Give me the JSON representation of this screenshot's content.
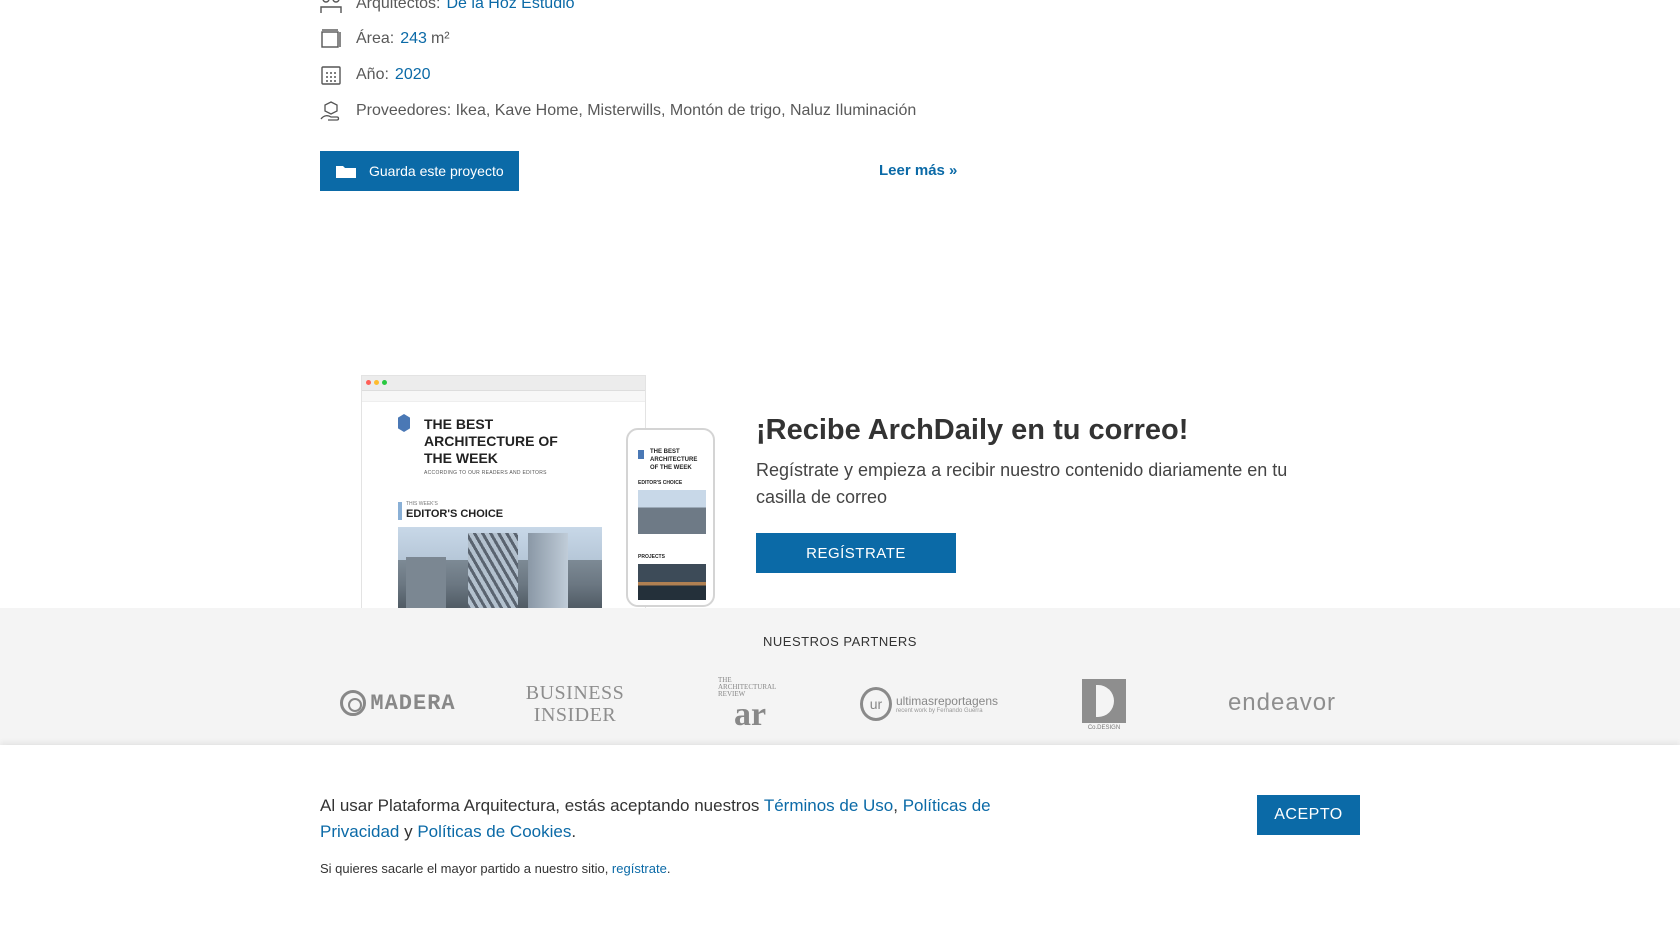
{
  "details": {
    "arquitectos_label": "Arquitectos:",
    "arquitectos_value": "De la Hoz Estudio",
    "area_label": "Área:",
    "area_value": "243",
    "area_unit": "m²",
    "anio_label": "Año:",
    "anio_value": "2020",
    "proveedores_text": "Proveedores: Ikea, Kave Home, Misterwills, Montón de trigo, Naluz Iluminación"
  },
  "actions": {
    "save_label": "Guarda este proyecto",
    "read_more": "Leer más »"
  },
  "newsletter": {
    "mock_title": "THE BEST ARCHITECTURE OF THE WEEK",
    "mock_caption": "ACCORDING TO OUR READERS AND EDITORS",
    "mock_kicker": "THIS WEEK'S",
    "mock_section": "EDITOR'S CHOICE",
    "phone_title": "THE BEST ARCHITECTURE OF THE WEEK",
    "phone_section1": "EDITOR'S CHOICE",
    "phone_section2": "PROJECTS",
    "title": "¡Recibe ArchDaily en tu correo!",
    "subtitle": "Regístrate y empieza a recibir nuestro contenido diariamente en tu casilla de correo",
    "button": "REGÍSTRATE"
  },
  "partners": {
    "title": "NUESTROS PARTNERS",
    "items": {
      "madera": "MADERA",
      "business_insider_1": "BUSINESS",
      "business_insider_2": "INSIDER",
      "ar_small": "THE ARCHITECTURAL REVIEW",
      "ar_big": "ar",
      "ur_mark": "ur",
      "ur_name": "ultimasreportagens",
      "ur_tag": "recent work by Fernando Guerra",
      "codesign": "Co.DESIGN",
      "endeavor": "endeavor"
    }
  },
  "cookie": {
    "text_pre": "Al usar Plataforma Arquitectura, estás aceptando nuestros ",
    "terms": "Términos de Uso",
    "comma": ", ",
    "privacy": "Políticas de Privacidad",
    "and": " y ",
    "cookies": "Políticas de Cookies",
    "period": ".",
    "small_pre": "Si quieres sacarle el mayor partido a nuestro sitio, ",
    "small_link": "regístrate",
    "small_post": ".",
    "accept": "ACEPTO"
  },
  "colors": {
    "accent": "#0b6aa7",
    "partners_bg": "#f4f4f4"
  }
}
